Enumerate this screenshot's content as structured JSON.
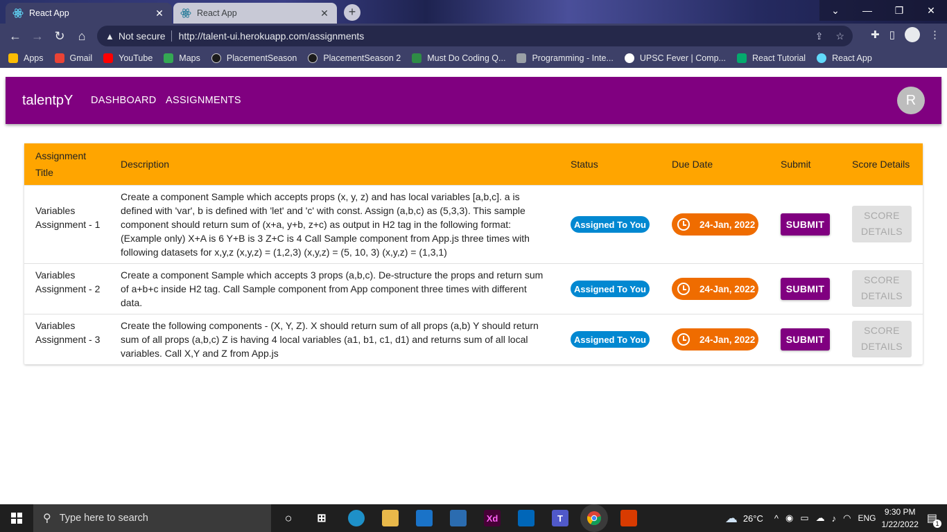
{
  "browser": {
    "tabs": [
      {
        "title": "React App",
        "active": true
      },
      {
        "title": "React App",
        "active": false
      }
    ],
    "new_tab": "+",
    "address": {
      "security_label": "Not secure",
      "url": "http://talent-ui.herokuapp.com/assignments"
    },
    "bookmarks": [
      {
        "label": "Apps",
        "color": "#fbbc04"
      },
      {
        "label": "Gmail",
        "color": "#ea4335"
      },
      {
        "label": "YouTube",
        "color": "#ff0000"
      },
      {
        "label": "Maps",
        "color": "#34a853"
      },
      {
        "label": "PlacementSeason",
        "color": "#1b1b1b"
      },
      {
        "label": "PlacementSeason 2",
        "color": "#1b1b1b"
      },
      {
        "label": "Must Do Coding Q...",
        "color": "#2f8d46"
      },
      {
        "label": "Programming - Inte...",
        "color": "#9aa0a6"
      },
      {
        "label": "UPSC Fever | Comp...",
        "color": "#ffffff"
      },
      {
        "label": "React Tutorial",
        "color": "#04aa6d"
      },
      {
        "label": "React App",
        "color": "#61dafb"
      }
    ]
  },
  "app": {
    "brand": "talentpY",
    "nav": {
      "dashboard": "DASHBOARD",
      "assignments": "ASSIGNMENTS"
    },
    "avatar_initial": "R",
    "colors": {
      "primary": "#800080",
      "header": "#ffa500",
      "status": "#0288d1",
      "due": "#ef6c00"
    }
  },
  "table": {
    "headers": {
      "title": "Assignment Title",
      "description": "Description",
      "status": "Status",
      "due_date": "Due Date",
      "submit": "Submit",
      "score": "Score Details"
    },
    "rows": [
      {
        "title": "Variables Assignment - 1",
        "description": "Create a component Sample which accepts props (x, y, z) and has local variables [a,b,c]. a is defined with 'var', b is defined with 'let' and 'c' with const. Assign (a,b,c) as (5,3,3). This sample component should return sum of (x+a, y+b, z+c) as output in H2 tag in the following format: (Example only) X+A is 6 Y+B is 3 Z+C is 4 Call Sample component from App.js three times with following datasets for x,y,z (x,y,z) = (1,2,3) (x,y,z) = (5, 10, 3) (x,y,z) = (1,3,1)",
        "status": "Assigned To You",
        "due": "24-Jan, 2022",
        "submit": "SUBMIT",
        "score": "SCORE DETAILS"
      },
      {
        "title": "Variables Assignment - 2",
        "description": "Create a component Sample which accepts 3 props (a,b,c). De-structure the props and return sum of a+b+c inside H2 tag. Call Sample component from App component three times with different data.",
        "status": "Assigned To You",
        "due": "24-Jan, 2022",
        "submit": "SUBMIT",
        "score": "SCORE DETAILS"
      },
      {
        "title": "Variables Assignment - 3",
        "description": "Create the following components - (X, Y, Z). X should return sum of all props (a,b) Y should return sum of all props (a,b,c) Z is having 4 local variables (a1, b1, c1, d1) and returns sum of all local variables. Call X,Y and Z from App.js",
        "status": "Assigned To You",
        "due": "24-Jan, 2022",
        "submit": "SUBMIT",
        "score": "SCORE DETAILS"
      }
    ]
  },
  "taskbar": {
    "search_placeholder": "Type here to search",
    "weather": "26°C",
    "language": "ENG",
    "time": "9:30 PM",
    "date": "1/22/2022",
    "notification_count": "1"
  }
}
